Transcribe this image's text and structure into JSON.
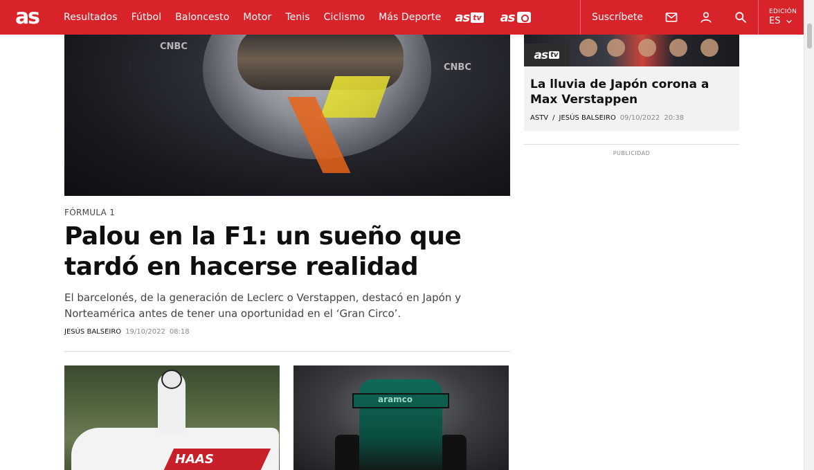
{
  "header": {
    "logo_text": "as",
    "nav": [
      "Resultados",
      "Fútbol",
      "Baloncesto",
      "Motor",
      "Tenis",
      "Ciclismo",
      "Más Deporte"
    ],
    "astv_text": "as",
    "astv_badge": "tv",
    "asfoto_text": "as",
    "subscribe_label": "Suscríbete",
    "edition_label": "EDICIÓN",
    "edition_value": "ES",
    "brand_color": "#d8232a"
  },
  "main_article": {
    "kicker": "FÓRMULA 1",
    "title": "Palou en la F1: un sueño que tardó en hacerse realidad",
    "dek": "El barcelonés, de la generación de Leclerc o Verstappen, destacó en Japón y Norteamérica antes de tener una oportunidad en el ‘Gran Circo’.",
    "author": "JESÚS BALSEIRO",
    "date": "19/10/2022",
    "time": "08:18",
    "hero_sponsor_1": "CNBC",
    "hero_sponsor_2": "CNBC"
  },
  "thumbs": {
    "haas_text": "HAAS",
    "aston_text": "aramco"
  },
  "sidebar": {
    "badge_text": "as",
    "badge_tv": "tv",
    "title": "La lluvia de Japón corona a Max Verstappen",
    "section": "ASTV",
    "separator": "/",
    "author": "JESÚS BALSEIRO",
    "date": "09/10/2022",
    "time": "20:38",
    "ad_label": "PUBLICIDAD"
  }
}
